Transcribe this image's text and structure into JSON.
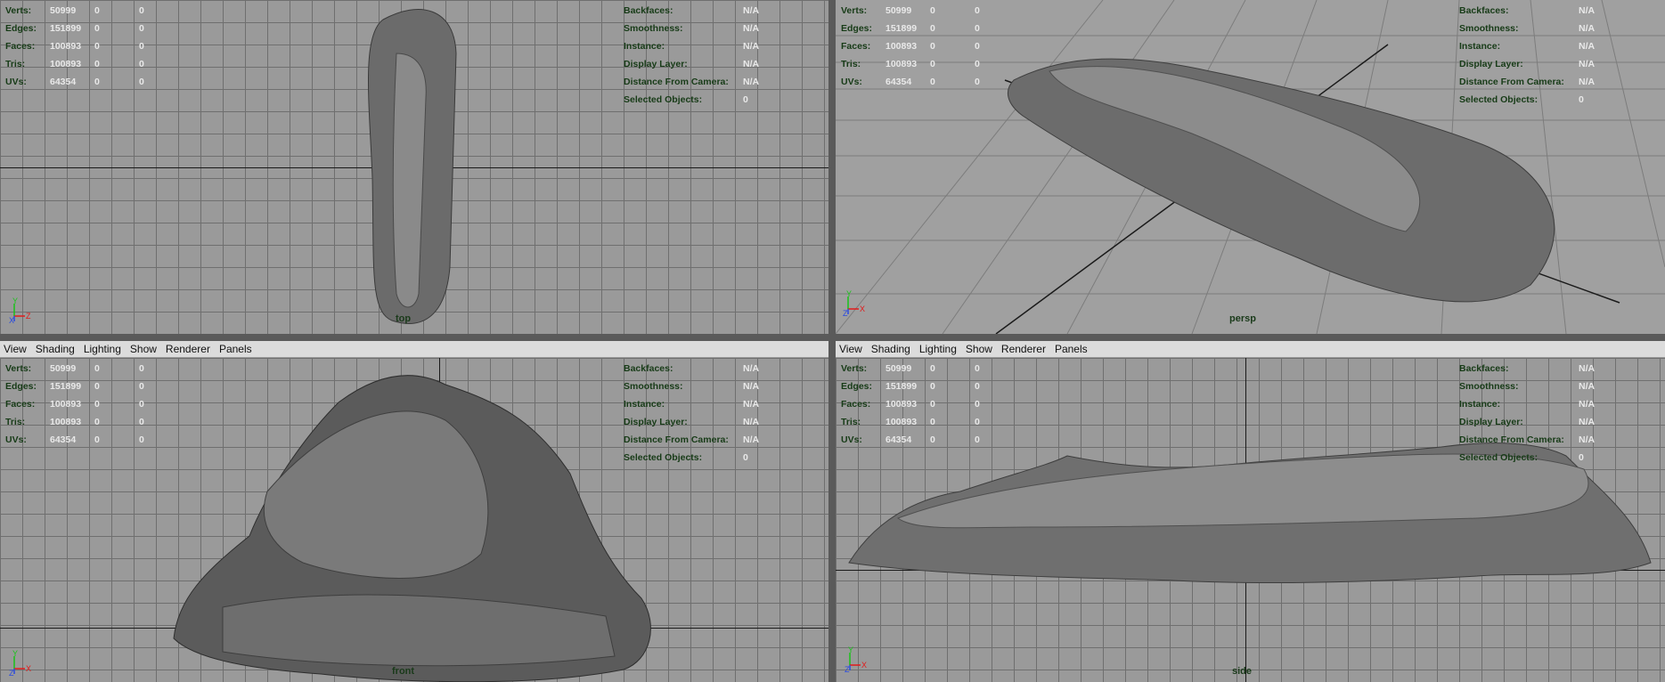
{
  "menu": [
    "View",
    "Shading",
    "Lighting",
    "Show",
    "Renderer",
    "Panels"
  ],
  "hud_left": [
    {
      "label": "Verts:",
      "v1": "50999",
      "v2": "0",
      "v3": "0"
    },
    {
      "label": "Edges:",
      "v1": "151899",
      "v2": "0",
      "v3": "0"
    },
    {
      "label": "Faces:",
      "v1": "100893",
      "v2": "0",
      "v3": "0"
    },
    {
      "label": "Tris:",
      "v1": "100893",
      "v2": "0",
      "v3": "0"
    },
    {
      "label": "UVs:",
      "v1": "64354",
      "v2": "0",
      "v3": "0"
    }
  ],
  "hud_right": [
    {
      "label": "Backfaces:",
      "val": "N/A"
    },
    {
      "label": "Smoothness:",
      "val": "N/A"
    },
    {
      "label": "Instance:",
      "val": "N/A"
    },
    {
      "label": "Display Layer:",
      "val": "N/A"
    },
    {
      "label": "Distance From Camera:",
      "val": "N/A"
    },
    {
      "label": "Selected Objects:",
      "val": "0"
    }
  ],
  "views": {
    "top": {
      "camera": "top"
    },
    "persp": {
      "camera": "persp"
    },
    "front": {
      "camera": "front"
    },
    "side": {
      "camera": "side"
    }
  },
  "axes": {
    "top": [
      "Y",
      "X",
      "Z"
    ],
    "persp": [
      "Y",
      "Z",
      "X"
    ],
    "front": [
      "Y",
      "Z",
      "X"
    ],
    "side": [
      "Y",
      "Z",
      "X"
    ]
  },
  "colors": {
    "grid": "#6f6f6f",
    "viewport": "#9a9a9a",
    "hud_label": "#173b17",
    "hud_value": "#e9e9e9",
    "menubar": "#dcdcdc"
  }
}
